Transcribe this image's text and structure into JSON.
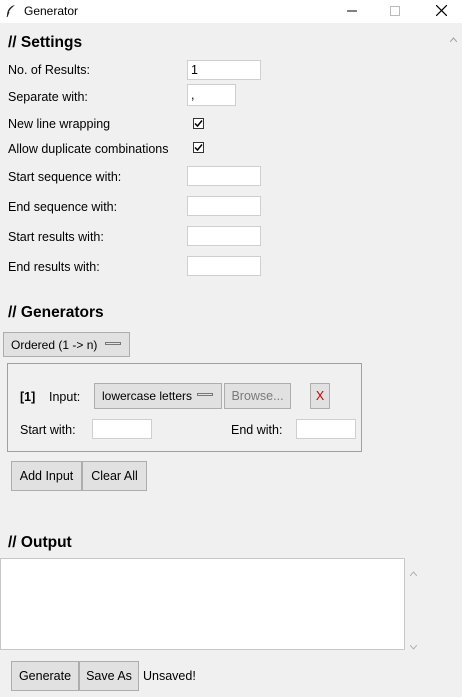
{
  "window": {
    "title": "Generator"
  },
  "settings": {
    "heading": "// Settings",
    "num_results_label": "No. of Results:",
    "num_results_value": "1",
    "separate_label": "Separate with:",
    "separate_value": ",",
    "newline_label": "New line wrapping",
    "newline_checked": true,
    "duplicates_label": "Allow duplicate combinations",
    "duplicates_checked": true,
    "start_seq_label": "Start sequence with:",
    "start_seq_value": "",
    "end_seq_label": "End sequence with:",
    "end_seq_value": "",
    "start_results_label": "Start results with:",
    "start_results_value": "",
    "end_results_label": "End results with:",
    "end_results_value": ""
  },
  "generators": {
    "heading": "// Generators",
    "mode_selected": "Ordered (1 -> n)",
    "item": {
      "index": "[1]",
      "input_label": "Input:",
      "input_selected": "lowercase letters",
      "browse_label": "Browse...",
      "remove_label": "X",
      "start_label": "Start with:",
      "start_value": "",
      "end_label": "End with:",
      "end_value": ""
    },
    "add_input_label": "Add Input",
    "clear_all_label": "Clear All"
  },
  "output": {
    "heading": "// Output",
    "text": "",
    "generate_label": "Generate",
    "save_as_label": "Save As",
    "status": "Unsaved!"
  },
  "colors": {
    "background": "#f0f0f0",
    "button": "#e1e1e1",
    "remove_text": "#cc0000",
    "disabled_text": "#7a7a7a"
  },
  "icons": {
    "app": "feather-icon",
    "minimize": "minimize-icon",
    "maximize": "maximize-icon",
    "close": "close-icon"
  }
}
